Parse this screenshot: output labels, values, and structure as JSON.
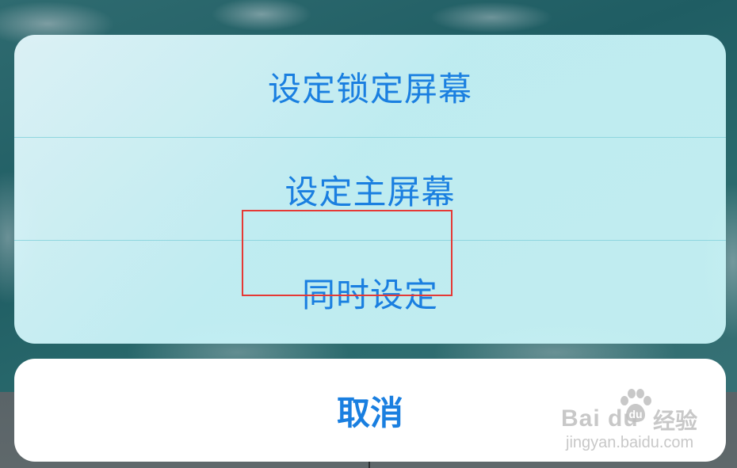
{
  "action_sheet": {
    "items": [
      {
        "label": "设定锁定屏幕"
      },
      {
        "label": "设定主屏幕"
      },
      {
        "label": "同时设定"
      }
    ],
    "cancel_label": "取消",
    "highlighted_item_index": 2
  },
  "watermark": {
    "brand": "Bai du",
    "product": "经验",
    "url": "jingyan.baidu.com"
  },
  "colors": {
    "action_text": "#1a7fe0",
    "highlight_border": "#e53935",
    "sheet_background": "#c7f3f8",
    "cancel_background": "#ffffff"
  }
}
